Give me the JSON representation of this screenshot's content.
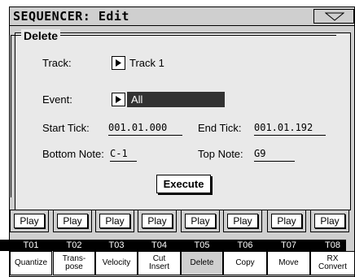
{
  "window": {
    "title": "SEQUENCER: Edit",
    "menu_icon": "triangle-down-icon"
  },
  "group_title": "Delete",
  "fields": {
    "track_label": "Track:",
    "track_value": "Track 1",
    "event_label": "Event:",
    "event_value": "All",
    "start_tick_label": "Start Tick:",
    "start_tick_value": "001.01.000",
    "end_tick_label": "End Tick:",
    "end_tick_value": "001.01.192",
    "bottom_note_label": "Bottom Note:",
    "bottom_note_value": "C-1",
    "top_note_label": "Top Note:",
    "top_note_value": "G9"
  },
  "execute_label": "Execute",
  "tracks": [
    {
      "play": "Play",
      "id": "T01"
    },
    {
      "play": "Play",
      "id": "T02"
    },
    {
      "play": "Play",
      "id": "T03"
    },
    {
      "play": "Play",
      "id": "T04"
    },
    {
      "play": "Play",
      "id": "T05"
    },
    {
      "play": "Play",
      "id": "T06"
    },
    {
      "play": "Play",
      "id": "T07"
    },
    {
      "play": "Play",
      "id": "T08"
    }
  ],
  "tabs": [
    {
      "label": "Quantize",
      "active": false
    },
    {
      "label": "Trans-\npose",
      "active": false
    },
    {
      "label": "Velocity",
      "active": false
    },
    {
      "label": "Cut\nInsert",
      "active": false
    },
    {
      "label": "Delete",
      "active": true
    },
    {
      "label": "Copy",
      "active": false
    },
    {
      "label": "Move",
      "active": false
    },
    {
      "label": "RX\nConvert",
      "active": false
    }
  ]
}
